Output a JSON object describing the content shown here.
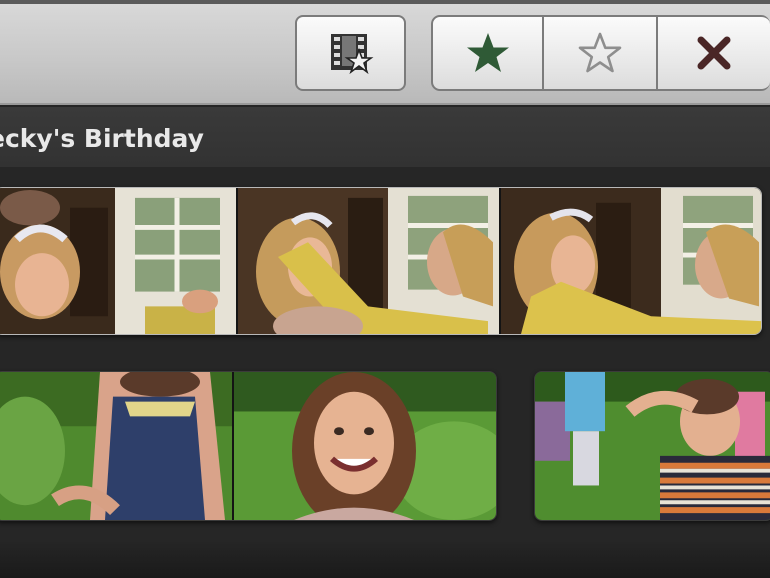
{
  "toolbar": {
    "convert_button": {
      "icon": "filmstrip-star-icon"
    },
    "favorite_button": {
      "icon": "filled-star-icon",
      "color": "#2f5a36"
    },
    "unmark_button": {
      "icon": "outline-star-icon",
      "color": "#9a9a9a"
    },
    "reject_button": {
      "icon": "x-icon",
      "color": "#4a2a2a"
    }
  },
  "event": {
    "title": "ecky's Birthday"
  },
  "clips": [
    {
      "name": "clip-1",
      "frames": 3
    },
    {
      "name": "clip-2",
      "frames": 2
    },
    {
      "name": "clip-3",
      "frames": 1
    }
  ]
}
